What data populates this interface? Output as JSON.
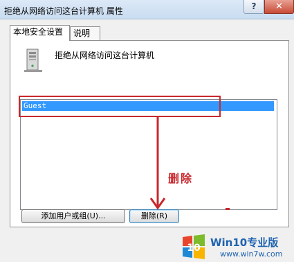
{
  "window": {
    "title": "拒绝从网络访问这台计算机 属性",
    "help_label": "?",
    "close_label": "✕"
  },
  "tabs": [
    {
      "label": "本地安全设置"
    },
    {
      "label": "说明"
    }
  ],
  "policy": {
    "name": "拒绝从网络访问这台计算机",
    "icon": "server-computer-icon"
  },
  "accounts": [
    "Guest"
  ],
  "buttons": {
    "add": "添加用户或组(U)...",
    "remove": "删除(R)"
  },
  "annotation": {
    "label": "删除",
    "color": "#c8282d"
  },
  "watermark": {
    "main": "Win10专业版",
    "url": "www.win7w.com",
    "logo_text": "10"
  }
}
